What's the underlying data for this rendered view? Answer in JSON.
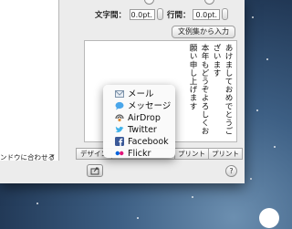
{
  "window": {
    "sidebar_label": "ンドウに合わせる"
  },
  "spacing": {
    "char_label": "文字間：",
    "char_value": "0.0pt.",
    "line_label": "行間：",
    "line_value": "0.0pt."
  },
  "buttons": {
    "import_text": "文例集から入力"
  },
  "preview": {
    "lines": [
      "あけましておめでとうご",
      "ざいます",
      "本年もどうぞよろしくお",
      "願い申し上げます"
    ]
  },
  "tabs": {
    "design": "デザイン",
    "print1": "プリント",
    "print2": "プリント"
  },
  "help": {
    "label": "?"
  },
  "share_menu": {
    "items": [
      {
        "label": "メール",
        "icon": "mail-icon",
        "color": "#8fa6bd"
      },
      {
        "label": "メッセージ",
        "icon": "messages-icon",
        "color": "#4aa6ea"
      },
      {
        "label": "AirDrop",
        "icon": "airdrop-icon",
        "color": "#555555"
      },
      {
        "label": "Twitter",
        "icon": "twitter-icon",
        "color": "#3fb2ea"
      },
      {
        "label": "Facebook",
        "icon": "facebook-icon",
        "color": "#3b5998"
      },
      {
        "label": "Flickr",
        "icon": "flickr-icon",
        "color": "#e0157a"
      }
    ]
  },
  "desktop": {
    "logo": ""
  }
}
